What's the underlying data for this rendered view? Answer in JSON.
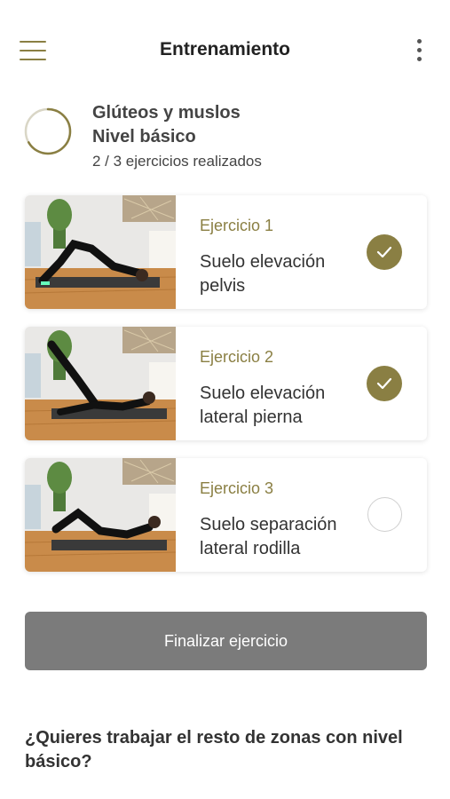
{
  "header": {
    "title": "Entrenamiento",
    "menu_icon": "hamburger-menu-icon",
    "more_icon": "more-vertical-icon"
  },
  "workout": {
    "title_line1": "Glúteos y muslos",
    "title_line2": "Nivel básico",
    "progress_text": "2 / 3 ejercicios realizados",
    "progress_fraction": 0.6667,
    "accent_color": "#8a7f43"
  },
  "exercises": [
    {
      "number_label": "Ejercicio 1",
      "name_line1": "Suelo elevación",
      "name_line2": "pelvis",
      "completed": true
    },
    {
      "number_label": "Ejercicio 2",
      "name_line1": "Suelo elevación",
      "name_line2": "lateral pierna",
      "completed": true
    },
    {
      "number_label": "Ejercicio 3",
      "name_line1": "Suelo separación",
      "name_line2": "lateral rodilla",
      "completed": false
    }
  ],
  "actions": {
    "finish_label": "Finalizar ejercicio",
    "finish_color": "#7b7b7b"
  },
  "footer": {
    "question": "¿Quieres trabajar el resto de zonas con nivel básico?"
  }
}
